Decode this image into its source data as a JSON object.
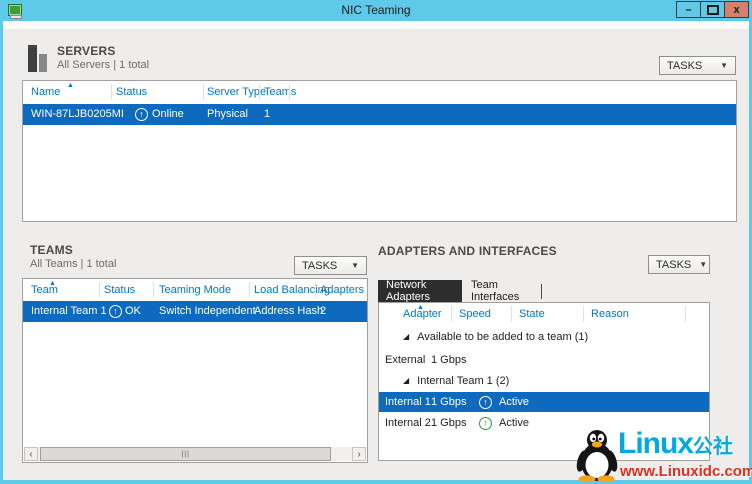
{
  "window": {
    "title": "NIC Teaming",
    "controls": {
      "minimize": "–",
      "close": "x"
    }
  },
  "icons": {
    "app_icon": "green-monitor",
    "dropdown_arrow": "▼",
    "sort_ascending": "▲",
    "status_up_arrow": "↑",
    "group_expander": "◢",
    "scrollbar_left": "‹",
    "scrollbar_right": "›",
    "scrollbar_grip": "|||"
  },
  "colors": {
    "titlebar": "#5ec9e9",
    "close_button": "#d4806e",
    "selection_blue": "#0d6abe",
    "column_header_text": "#0077c8",
    "active_tab_bg": "#2d2d2d",
    "status_green": "#2f9b33",
    "watermark_blue": "#00a9e2",
    "watermark_red": "#e62b1e"
  },
  "servers": {
    "title": "SERVERS",
    "subtitle": "All Servers | 1 total",
    "tasks_label": "TASKS",
    "columns": [
      "Name",
      "Status",
      "Server Type",
      "Teams"
    ],
    "rows": [
      {
        "name": "WIN-87LJB0205MI",
        "status": "Online",
        "server_type": "Physical",
        "teams": "1"
      }
    ]
  },
  "teams": {
    "title": "TEAMS",
    "subtitle": "All Teams | 1 total",
    "tasks_label": "TASKS",
    "columns": [
      "Team",
      "Status",
      "Teaming Mode",
      "Load Balancing",
      "Adapters"
    ],
    "rows": [
      {
        "team": "Internal Team 1",
        "status": "OK",
        "teaming_mode": "Switch Independent",
        "load_balancing": "Address Hash",
        "adapters": "2"
      }
    ]
  },
  "adapters": {
    "title": "ADAPTERS AND INTERFACES",
    "tasks_label": "TASKS",
    "tabs": [
      {
        "label": "Network Adapters"
      },
      {
        "label": "Team Interfaces"
      }
    ],
    "columns": [
      "Adapter",
      "Speed",
      "State",
      "Reason"
    ],
    "groups": [
      {
        "header": "Available to be added to a team (1)",
        "rows": [
          {
            "adapter": "External",
            "speed": "1 Gbps",
            "state": ""
          }
        ]
      },
      {
        "header": "Internal Team 1 (2)",
        "rows": [
          {
            "adapter": "Internal 1",
            "speed": "1 Gbps",
            "state": "Active"
          },
          {
            "adapter": "Internal 2",
            "speed": "1 Gbps",
            "state": "Active"
          }
        ]
      }
    ]
  },
  "watermark": {
    "brand": "Linux",
    "brand_suffix": "公社",
    "url": "www.Linuxidc.com"
  }
}
